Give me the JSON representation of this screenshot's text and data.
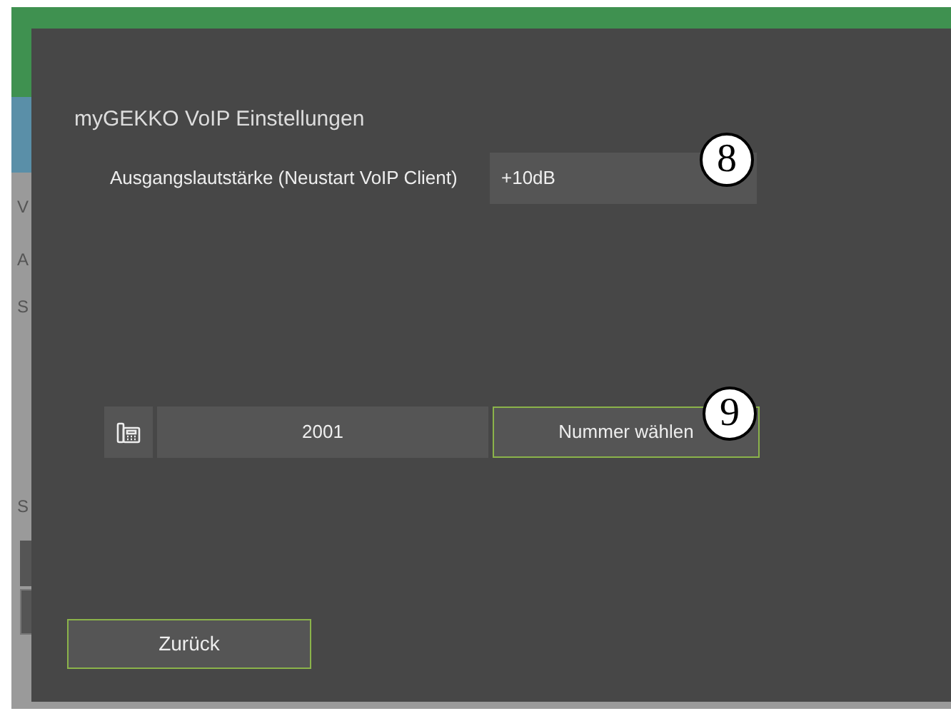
{
  "background": {
    "labels": [
      "V",
      "A",
      "S",
      "S"
    ]
  },
  "dialog": {
    "title": "myGEKKO VoIP Einstellungen",
    "setting": {
      "label": "Ausgangslautstärke (Neustart VoIP Client)",
      "value": "+10dB",
      "marker": "8"
    },
    "dial": {
      "number": "2001",
      "button": "Nummer wählen",
      "marker": "9"
    },
    "back_button": "Zurück"
  }
}
